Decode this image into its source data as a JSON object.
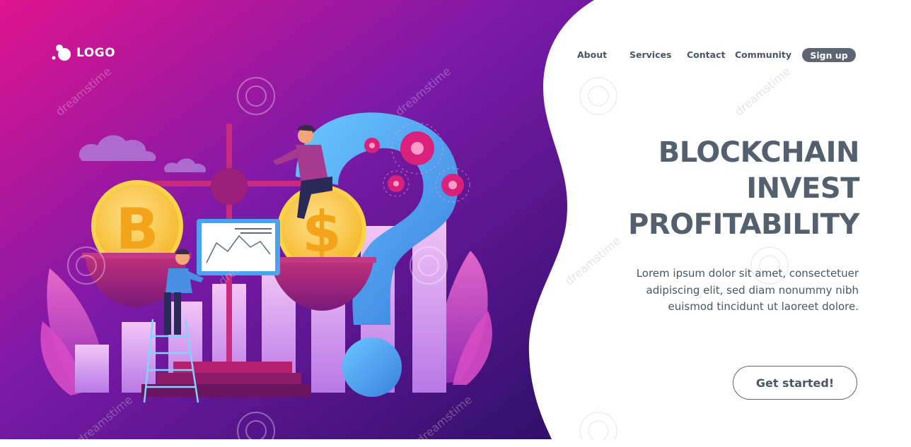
{
  "logo": {
    "icon": "logo-dots-icon",
    "text": "LOGO"
  },
  "nav": {
    "items": [
      {
        "label": "About"
      },
      {
        "label": "Services"
      },
      {
        "label": "Contact"
      },
      {
        "label": "Community"
      }
    ],
    "signup_label": "Sign up"
  },
  "hero": {
    "title_lines": [
      "BLOCKCHAIN",
      "INVEST",
      "PROFITABILITY"
    ],
    "description_lines": [
      "Lorem ipsum dolor sit amet, consectetuer",
      "adipiscing elit, sed diam nonummy nibh",
      "euismod tincidunt ut laoreet dolore."
    ],
    "cta_label": "Get started!"
  },
  "watermark": {
    "text": "dreamstime"
  },
  "colors": {
    "gradient_start": "#e0148f",
    "gradient_mid": "#7b1aa8",
    "gradient_end": "#2a0f66",
    "text_gray": "#55606e",
    "button_gray": "#5d6672",
    "coin_gold": "#f7c531",
    "question_blue": "#4ba3f0"
  }
}
